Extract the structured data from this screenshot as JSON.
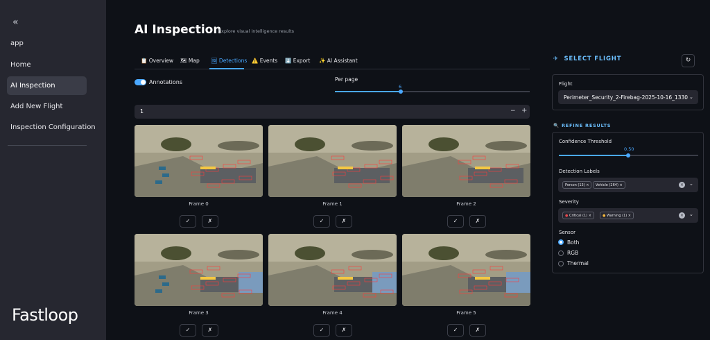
{
  "sidebar": {
    "collapse_glyph": "«",
    "app_label": "app",
    "items": [
      {
        "label": "Home"
      },
      {
        "label": "AI Inspection"
      },
      {
        "label": "Add New Flight"
      },
      {
        "label": "Inspection Configuration"
      }
    ],
    "logo": "Fastloop"
  },
  "header": {
    "title": "AI Inspection",
    "subtitle": "Explore visual intelligence results"
  },
  "tabs": [
    {
      "icon": "📋",
      "label": "Overview"
    },
    {
      "icon": "🗺",
      "label": "Map"
    },
    {
      "icon": "🖼",
      "label": "Detections"
    },
    {
      "icon": "⚠️",
      "label": "Events"
    },
    {
      "icon": "⬇️",
      "label": "Export"
    },
    {
      "icon": "✨",
      "label": "AI Assistant"
    }
  ],
  "controls": {
    "annotations_label": "Annotations",
    "annotations_on": true,
    "per_page_label": "Per page",
    "per_page_value": "6",
    "page_number": "1",
    "minus": "−",
    "plus": "+"
  },
  "frames": [
    {
      "caption": "Frame 0"
    },
    {
      "caption": "Frame 1"
    },
    {
      "caption": "Frame 2"
    },
    {
      "caption": "Frame 3"
    },
    {
      "caption": "Frame 4"
    },
    {
      "caption": "Frame 5"
    }
  ],
  "frame_buttons": {
    "approve": "✓",
    "reject": "✗"
  },
  "right_panel": {
    "select_flight_title": "SELECT FLIGHT",
    "refresh_glyph": "↻",
    "flight_label": "Flight",
    "flight_value": "Perimeter_Security_2-Firebag-2025-10-16_1330",
    "refine_title": "REFINE RESULTS",
    "confidence_label": "Confidence Threshold",
    "confidence_value": "0.50",
    "detection_labels_label": "Detection Labels",
    "detection_tags": [
      "Person (13)",
      "Vehicle (264)"
    ],
    "severity_label": "Severity",
    "severity_tags": [
      "Critical (1)",
      "Warning (1)"
    ],
    "sensor_label": "Sensor",
    "sensor_options": [
      {
        "label": "Both",
        "selected": true
      },
      {
        "label": "RGB",
        "selected": false
      },
      {
        "label": "Thermal",
        "selected": false
      }
    ]
  },
  "colors": {
    "accent": "#4aa8ff",
    "sidebar_bg": "#262730",
    "page_bg": "#0e1117",
    "critical": "#e5484d",
    "warning": "#f5b83d"
  }
}
